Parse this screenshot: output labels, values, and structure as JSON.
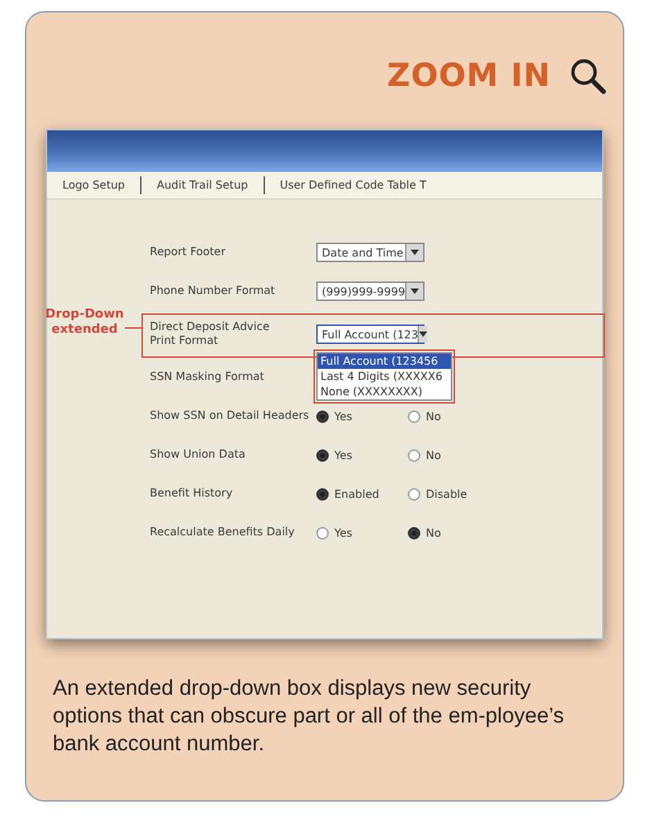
{
  "header": {
    "title": "ZOOM IN"
  },
  "screen": {
    "tabs": [
      {
        "label": "Logo Setup",
        "selected": false
      },
      {
        "label": "Audit Trail Setup",
        "selected": false
      },
      {
        "label": "User Defined Code Table T",
        "selected": false
      }
    ],
    "rows": [
      {
        "kind": "select",
        "label": "Report Footer",
        "value": "Date and Time"
      },
      {
        "kind": "select",
        "label": "Phone Number Format",
        "value": "(999)999-9999"
      },
      {
        "kind": "select",
        "label": "Direct Deposit Advice Print Format",
        "value": "Full Account (123",
        "expanded": true,
        "options": [
          {
            "label": "Full Account (123456",
            "selected": true
          },
          {
            "label": "Last 4 Digits (XXXXX6",
            "selected": false
          },
          {
            "label": "None (XXXXXXXX)",
            "selected": false
          }
        ]
      },
      {
        "kind": "covered",
        "label": "SSN Masking Format"
      },
      {
        "kind": "radio",
        "label": "Show SSN on Detail Headers",
        "options": [
          {
            "label": "Yes",
            "selected": true
          },
          {
            "label": "No",
            "selected": false
          }
        ]
      },
      {
        "kind": "radio",
        "label": "Show Union Data",
        "options": [
          {
            "label": "Yes",
            "selected": true
          },
          {
            "label": "No",
            "selected": false
          }
        ]
      },
      {
        "kind": "radio",
        "label": "Benefit History",
        "options": [
          {
            "label": "Enabled",
            "selected": true
          },
          {
            "label": "Disable",
            "selected": false
          }
        ]
      },
      {
        "kind": "radio",
        "label": "Recalculate Benefits Daily",
        "options": [
          {
            "label": "Yes",
            "selected": false
          },
          {
            "label": "No",
            "selected": true
          }
        ]
      }
    ],
    "annotation": "Drop-Down extended"
  },
  "caption": "An extended drop-down box displays new security options that can obscure part or all of the em-ployee’s bank account number."
}
